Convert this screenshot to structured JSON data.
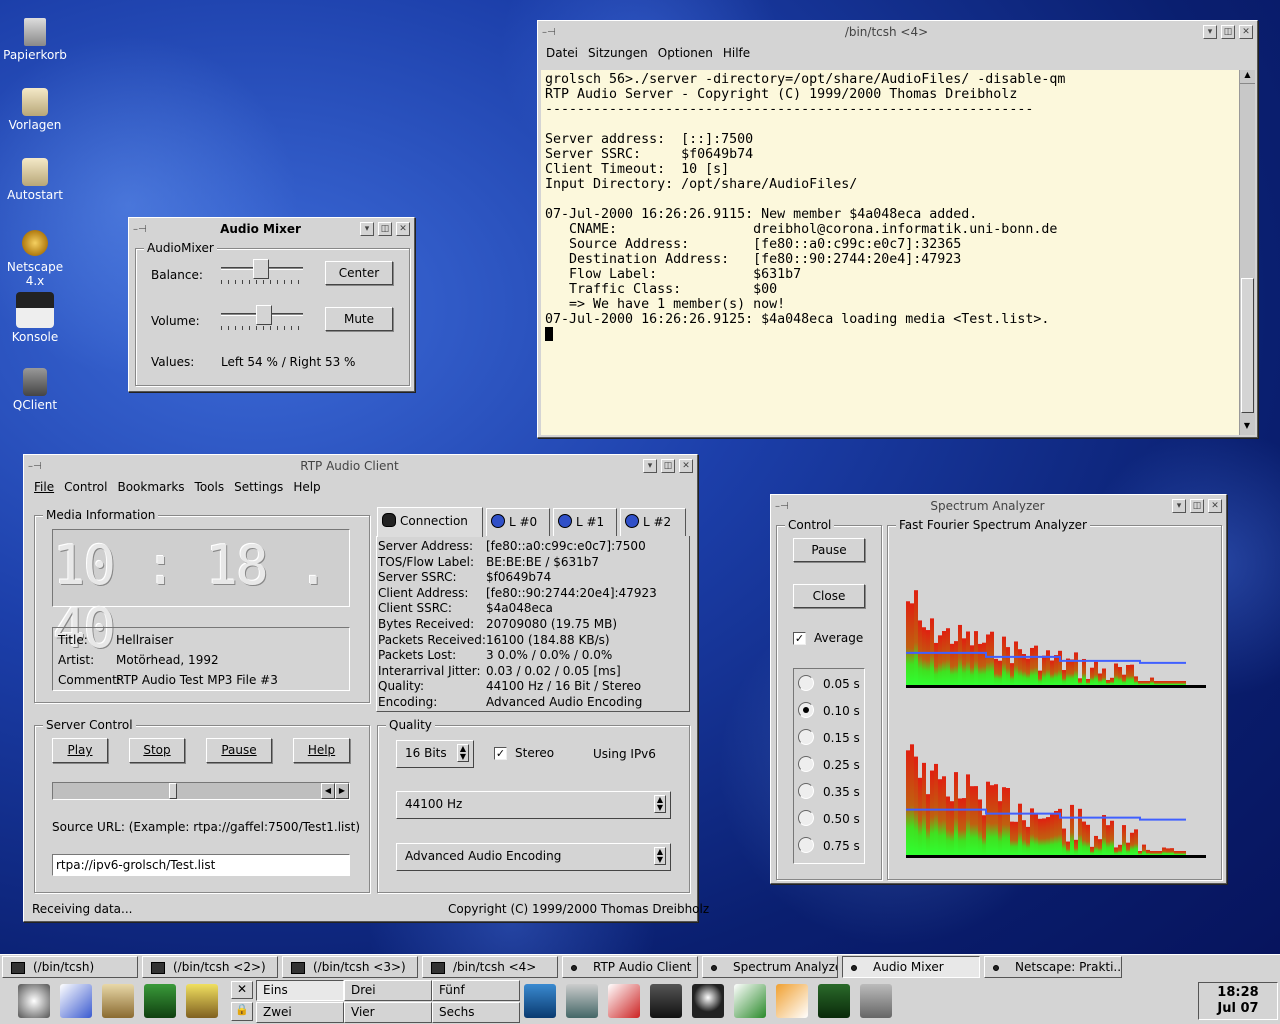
{
  "desktop_icons": [
    {
      "label": "Papierkorb",
      "icon": "trash-icon"
    },
    {
      "label": "Vorlagen",
      "icon": "folder-icon"
    },
    {
      "label": "Autostart",
      "icon": "folder-icon"
    },
    {
      "label": "Netscape 4.x",
      "icon": "netscape-icon"
    },
    {
      "label": "Konsole",
      "icon": "terminal-icon"
    },
    {
      "label": "QClient",
      "icon": "client-icon"
    }
  ],
  "terminal": {
    "title": "/bin/tcsh <4>",
    "menu": [
      "Datei",
      "Sitzungen",
      "Optionen",
      "Hilfe"
    ],
    "lines": [
      "grolsch 56>./server -directory=/opt/share/AudioFiles/ -disable-qm",
      "RTP Audio Server - Copyright (C) 1999/2000 Thomas Dreibholz",
      "-------------------------------------------------------------",
      "",
      "Server address:  [::]:7500",
      "Server SSRC:     $f0649b74",
      "Client Timeout:  10 [s]",
      "Input Directory: /opt/share/AudioFiles/",
      "",
      "07-Jul-2000 16:26:26.9115: New member $4a048eca added.",
      "   CNAME:                 dreibhol@corona.informatik.uni-bonn.de",
      "   Source Address:        [fe80::a0:c99c:e0c7]:32365",
      "   Destination Address:   [fe80::90:2744:20e4]:47923",
      "   Flow Label:            $631b7",
      "   Traffic Class:         $00",
      "   => We have 1 member(s) now!",
      "07-Jul-2000 16:26:26.9125: $4a048eca loading media <Test.list>."
    ]
  },
  "mixer": {
    "title": "Audio Mixer",
    "group": "AudioMixer",
    "balance_label": "Balance:",
    "volume_label": "Volume:",
    "center_button": "Center",
    "mute_button": "Mute",
    "values_label": "Values:",
    "values_text": "Left 54 % / Right 53 %"
  },
  "client": {
    "title": "RTP Audio Client",
    "menu": [
      "File",
      "Control",
      "Bookmarks",
      "Tools",
      "Settings",
      "Help"
    ],
    "media_group": "Media Information",
    "time": "10 : 18 . 40",
    "title_label": "Title:",
    "title_value": "Hellraiser",
    "artist_label": "Artist:",
    "artist_value": "Motörhead, 1992",
    "comment_label": "Comment:",
    "comment_value": "RTP Audio Test MP3 File #3",
    "tabs": [
      "Connection",
      "L #0",
      "L #1",
      "L #2"
    ],
    "conn": [
      {
        "k": "Server Address:",
        "v": "[fe80::a0:c99c:e0c7]:7500"
      },
      {
        "k": "TOS/Flow Label:",
        "v": "BE:BE:BE / $631b7"
      },
      {
        "k": "Server SSRC:",
        "v": "$f0649b74"
      },
      {
        "k": "Client Address:",
        "v": "[fe80::90:2744:20e4]:47923"
      },
      {
        "k": "Client SSRC:",
        "v": "$4a048eca"
      },
      {
        "k": "Bytes Received:",
        "v": "20709080 (19.75 MB)"
      },
      {
        "k": "Packets Received:",
        "v": "16100 (184.88 KB/s)"
      },
      {
        "k": "Packets Lost:",
        "v": "3 0.0% / 0.0% / 0.0%"
      },
      {
        "k": "Interarrival Jitter:",
        "v": "0.03 / 0.02 / 0.05 [ms]"
      },
      {
        "k": "Quality:",
        "v": "44100 Hz / 16 Bit / Stereo"
      },
      {
        "k": "Encoding:",
        "v": "Advanced Audio Encoding"
      }
    ],
    "server_group": "Server Control",
    "play": "Play",
    "stop": "Stop",
    "pause": "Pause",
    "help": "Help",
    "url_hint": "Source URL: (Example: rtpa://gaffel:7500/Test1.list)",
    "url_value": "rtpa://ipv6-grolsch/Test.list",
    "quality_group": "Quality",
    "bits": "16 Bits",
    "stereo": "Stereo",
    "ipv6": "Using IPv6",
    "rate": "44100 Hz",
    "encoding": "Advanced Audio Encoding",
    "status": "Receiving data...",
    "copyright": "Copyright (C) 1999/2000 Thomas Dreibholz",
    "position": 0.45
  },
  "spectrum": {
    "title": "Spectrum Analyzer",
    "control_group": "Control",
    "fft_group": "Fast Fourier Spectrum Analyzer",
    "pause": "Pause",
    "close": "Close",
    "average": "Average",
    "intervals": [
      "0.05 s",
      "0.10 s",
      "0.15 s",
      "0.25 s",
      "0.35 s",
      "0.50 s",
      "0.75 s"
    ],
    "selected": "0.10 s"
  },
  "taskbar": {
    "tasks": [
      "(/bin/tcsh)",
      "(/bin/tcsh <2>)",
      "(/bin/tcsh <3>)",
      "/bin/tcsh <4>",
      "RTP Audio Client",
      "Spectrum Analyzer",
      "Audio Mixer",
      "Netscape: Prakti..."
    ],
    "desktops": [
      "Eins",
      "Drei",
      "Fünf",
      "Zwei",
      "Vier",
      "Sechs"
    ],
    "clock_time": "18:28",
    "clock_date": "Jul 07"
  }
}
